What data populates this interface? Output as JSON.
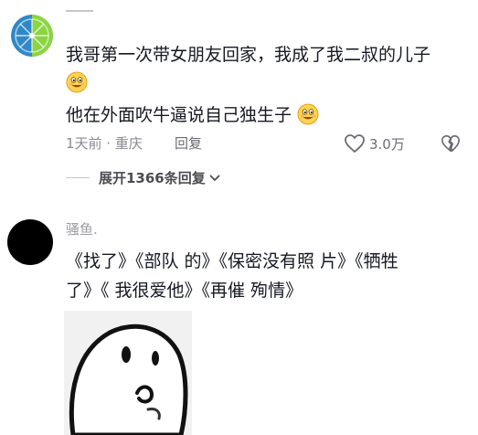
{
  "comment1": {
    "avatar_icon": "lime-slice-avatar",
    "line1": "我哥第一次带女朋友回家，我成了我二叔的儿子",
    "line2_emoji": "smile-emoji",
    "line3": "他在外面吹牛逼说自己独生子",
    "line3_emoji": "smile-emoji",
    "meta": "1天前 · 重庆",
    "reply_label": "回复",
    "like_count": "3.0万",
    "like_icon": "heart-outline-icon",
    "dislike_icon": "broken-heart-icon",
    "expand_label": "展开1366条回复",
    "expand_icon": "chevron-down-icon"
  },
  "comment2": {
    "author": "骚鱼.",
    "line1": "《找了》《部队 的》《保密没有照 片》《牺牲",
    "line2": "了》《 我很爱他》《再催 殉情》",
    "sticker_icon": "ghost-sticker"
  },
  "colors": {
    "text": "#161823",
    "meta": "#8a8b91",
    "action": "#6b6c72",
    "lime": "#8bd442",
    "lime_blue": "#2f88c8"
  }
}
